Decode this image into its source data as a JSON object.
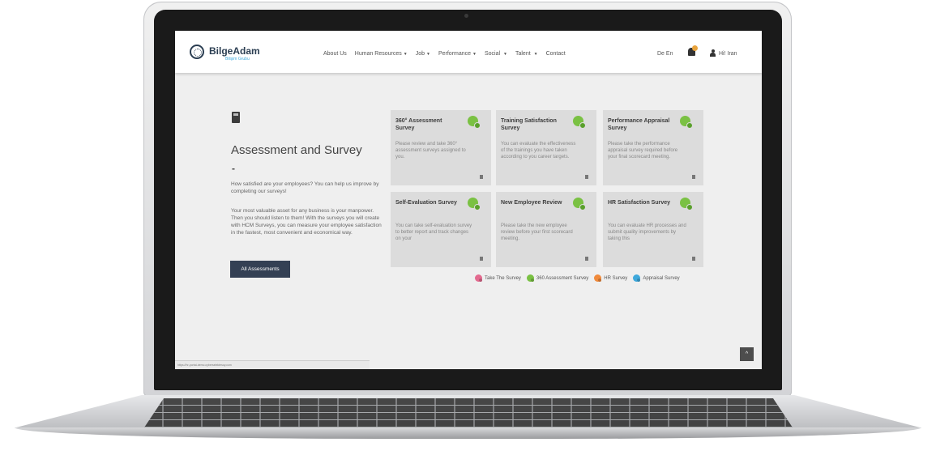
{
  "header": {
    "logo_text": "BilgeAdam",
    "logo_sub": "Bilişim Grubu",
    "nav": [
      {
        "label": "About Us",
        "dropdown": false
      },
      {
        "label": "Human Resources",
        "dropdown": true
      },
      {
        "label": "Job",
        "dropdown": true
      },
      {
        "label": "Performance",
        "dropdown": true
      },
      {
        "label": "Social",
        "dropdown": true
      },
      {
        "label": "Talent",
        "dropdown": true
      },
      {
        "label": "Contact",
        "dropdown": false
      }
    ],
    "lang_de": "De",
    "lang_en": "En",
    "user": "Hi! Iran",
    "icons": [
      "bell-icon",
      "user-icon"
    ]
  },
  "intro": {
    "title": "Assessment and Survey",
    "dash": "-",
    "p1": "How satisfied are your employees? You can help us improve by completing our surveys!",
    "p2": "Your most valuable asset for any business is your manpower. Then you should listen to them! With the surveys you will create with HCM Surveys, you can measure your employee satisfaction in the fastest, most convenient and economical way.",
    "button": "All Assessments"
  },
  "cards": [
    {
      "title": "360° Assessment Survey",
      "desc": "Please review and take 360° assessment surveys assigned to you."
    },
    {
      "title": "Training Satisfaction Survey",
      "desc": "You can evaluate the effectiveness of the trainings you have taken according to you career targets."
    },
    {
      "title": "Performance Appraisal Survey",
      "desc": "Please take the performance appraisal survey required before your final scorecard meeting."
    },
    {
      "title": "Self-Evaluation Survey",
      "desc": "You can take self-evaluation survey to better report and track changes on your"
    },
    {
      "title": "New Employee Review",
      "desc": "Please take the new employee review before your first scorecard meeting."
    },
    {
      "title": "HR Satisfaction Survey",
      "desc": "You can evaluate HR processes and submit quality improvements by taking this"
    }
  ],
  "legend": [
    {
      "label": "Take The Survey",
      "color": "#e36a8f"
    },
    {
      "label": "360 Assessment Survey",
      "color": "#7ac143"
    },
    {
      "label": "HR Survey",
      "color": "#f08a3c"
    },
    {
      "label": "Appraisal Survey",
      "color": "#3fa9dc"
    }
  ],
  "status_url": "https://hr-portal-demo.cyberselektesoy.com",
  "scroll_top": "^",
  "colors": {
    "accent": "#344054",
    "badge": "#7ac143",
    "card_bg": "#dcdcdc"
  }
}
